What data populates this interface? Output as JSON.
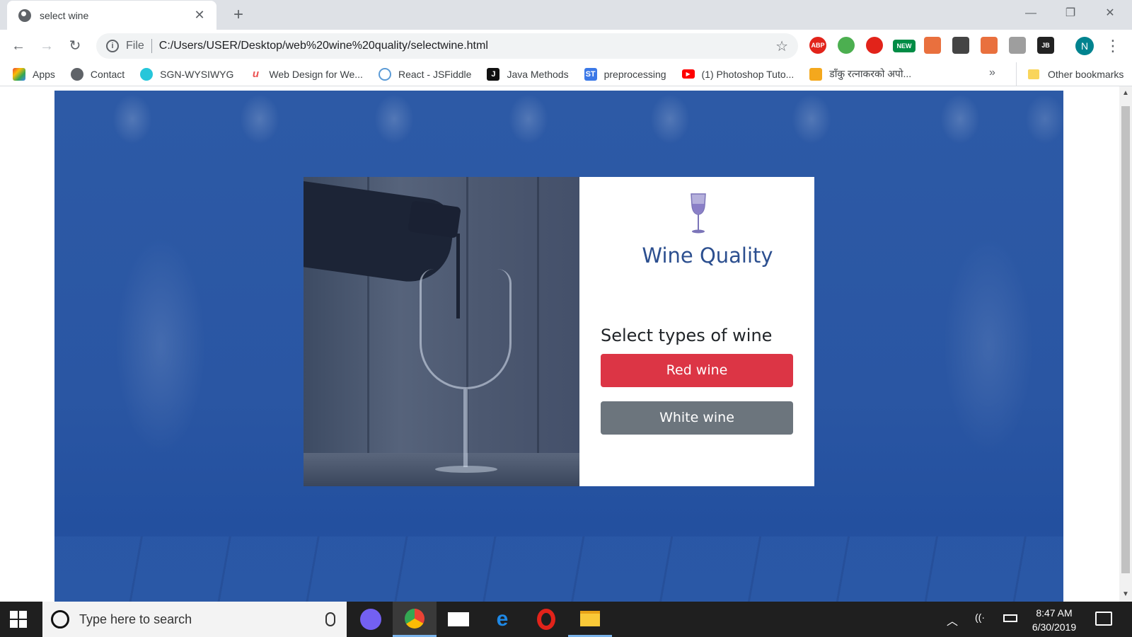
{
  "browser": {
    "tab_title": "select wine",
    "tab_close": "✕",
    "new_tab": "+",
    "window_controls": {
      "minimize": "—",
      "restore": "❐",
      "close": "✕"
    },
    "nav": {
      "back": "←",
      "forward": "→",
      "reload": "↻"
    },
    "omnibox": {
      "info": "i",
      "scheme_label": "File",
      "url": "C:/Users/USER/Desktop/web%20wine%20quality/selectwine.html",
      "star": "☆"
    },
    "extensions": [
      {
        "name": "adblock-plus-icon",
        "label": "ABP",
        "color": "#e2231a"
      },
      {
        "name": "globe-extension-icon",
        "label": "",
        "color": "#4caf50"
      },
      {
        "name": "opera-extension-icon",
        "label": "",
        "color": "#e2231a"
      },
      {
        "name": "new-extension-icon",
        "label": "NEW",
        "color": "#008c45"
      },
      {
        "name": "tv-extension-icon",
        "label": "",
        "color": "#e9703e"
      },
      {
        "name": "download-extension-icon",
        "label": "",
        "color": "#444444"
      },
      {
        "name": "tv2-extension-icon",
        "label": "",
        "color": "#e9703e"
      },
      {
        "name": "box-extension-icon",
        "label": "",
        "color": "#9e9e9e"
      },
      {
        "name": "jetbrains-extension-icon",
        "label": "JB",
        "color": "#222222"
      }
    ],
    "profile_initial": "N",
    "menu": "⋮"
  },
  "bookmarks": {
    "items": [
      {
        "label": "Apps",
        "icon": "apps-grid-icon",
        "color": "#ea4335"
      },
      {
        "label": "Contact",
        "icon": "globe-icon",
        "color": "#5f6368"
      },
      {
        "label": "SGN-WYSIWYG",
        "icon": "sgn-icon",
        "color": "#26c6da"
      },
      {
        "label": "Web Design for We...",
        "icon": "udemy-icon",
        "color": "#ec5252"
      },
      {
        "label": "React - JSFiddle",
        "icon": "jsfiddle-icon",
        "color": "#5c9bd6"
      },
      {
        "label": "Java Methods",
        "icon": "j-icon",
        "color": "#111111"
      },
      {
        "label": "preprocessing",
        "icon": "st-icon",
        "color": "#3b78e7"
      },
      {
        "label": "(1) Photoshop Tuto...",
        "icon": "youtube-icon",
        "color": "#ff0000"
      },
      {
        "label": "डाँकु रत्नाकरको अपो...",
        "icon": "doc-icon",
        "color": "#f4a81d"
      }
    ],
    "more": "»",
    "other": "Other bookmarks"
  },
  "page": {
    "brand_title": "Wine Quality",
    "prompt": "Select types of wine",
    "buttons": {
      "red": "Red wine",
      "white": "White wine"
    },
    "colors": {
      "brand": "#2c4f8f",
      "red_button": "#dc3545",
      "grey_button": "#6c757d",
      "background": "#2a56a3"
    }
  },
  "taskbar": {
    "search_placeholder": "Type here to search",
    "apps": [
      "viber",
      "chrome",
      "mail",
      "edge",
      "opera",
      "file-explorer"
    ],
    "time": "8:47 AM",
    "date": "6/30/2019"
  }
}
